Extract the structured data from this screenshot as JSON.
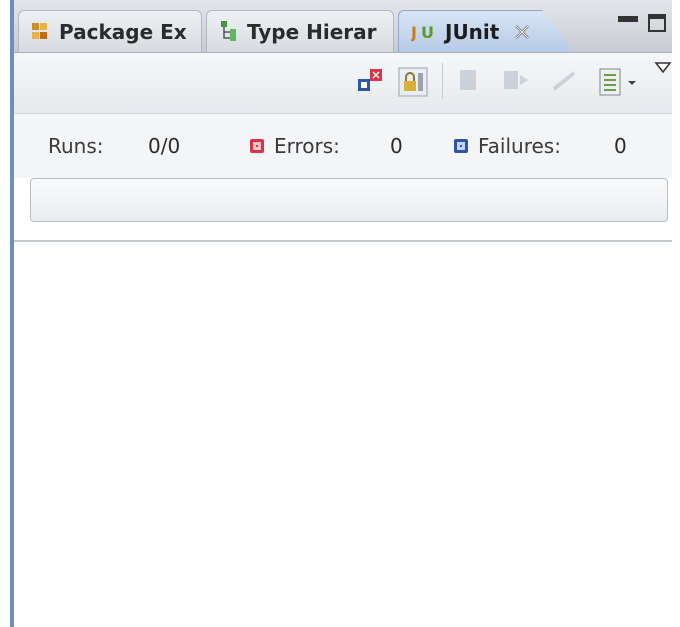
{
  "tabs": [
    {
      "label": "Package Ex",
      "icon": "package-explorer-icon"
    },
    {
      "label": "Type Hierar",
      "icon": "type-hierarchy-icon"
    },
    {
      "label": "JUnit",
      "icon": "junit-icon",
      "active": true
    }
  ],
  "counters": {
    "runs_label": "Runs:",
    "runs_value": "0/0",
    "errors_label": "Errors:",
    "errors_value": "0",
    "failures_label": "Failures:",
    "failures_value": "0"
  },
  "colors": {
    "error": "#d8344a",
    "failure": "#2e56a8",
    "active_tab": "#b7cbe6",
    "window_border": "#6f8fb8"
  },
  "progress": 0
}
